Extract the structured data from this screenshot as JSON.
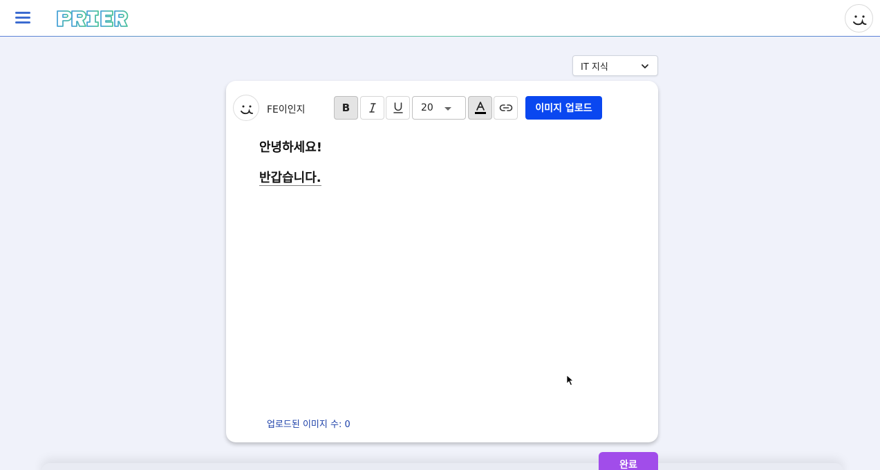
{
  "header": {
    "logo_text": "PRIER",
    "menu_icon": "hamburger-menu-icon",
    "profile_icon": "smiley-face-icon"
  },
  "category": {
    "selected": "IT 지식",
    "icon": "chevron-down-icon"
  },
  "editor": {
    "username": "FE이인지",
    "toolbar": {
      "bold_label": "B",
      "font_size": "20",
      "upload_label": "이미지 업로드",
      "bold_active": true
    },
    "content": [
      "안녕하세요!",
      "반갑습니다."
    ],
    "image_count_label": "업로드된 이미지 수: 0"
  },
  "footer": {
    "done_label": "완료"
  },
  "colors": {
    "accent_blue": "#0a47f0",
    "done_purple": "#a14dea",
    "logo_blue": "#3b6bd0",
    "logo_green": "#4dc39a"
  }
}
